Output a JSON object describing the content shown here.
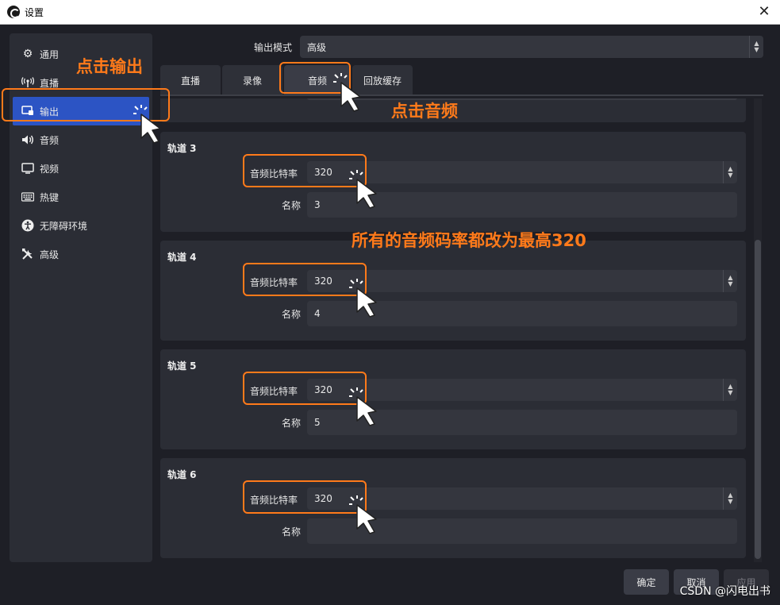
{
  "window": {
    "title": "设置",
    "close_glyph": "✕"
  },
  "sidebar": {
    "items": [
      {
        "label": "通用",
        "icon": "gear-icon",
        "glyph": "⚙"
      },
      {
        "label": "直播",
        "icon": "broadcast-icon",
        "glyph": "📡"
      },
      {
        "label": "输出",
        "icon": "output-icon",
        "glyph": "🖵"
      },
      {
        "label": "音频",
        "icon": "speaker-icon",
        "glyph": "🔊"
      },
      {
        "label": "视频",
        "icon": "monitor-icon",
        "glyph": "🖵"
      },
      {
        "label": "热键",
        "icon": "keyboard-icon",
        "glyph": "⌨"
      },
      {
        "label": "无障碍环境",
        "icon": "accessibility-icon",
        "glyph": "♿"
      },
      {
        "label": "高级",
        "icon": "tools-icon",
        "glyph": "✂"
      }
    ],
    "active_index": 2
  },
  "output_mode": {
    "label": "输出模式",
    "value": "高级"
  },
  "tabs": [
    {
      "label": "直播"
    },
    {
      "label": "录像"
    },
    {
      "label": "音频"
    },
    {
      "label": "回放缓存"
    }
  ],
  "active_tab": 2,
  "tracks": [
    {
      "title": "轨道 3",
      "bitrate_label": "音频比特率",
      "bitrate": "320",
      "name_label": "名称",
      "name": "3"
    },
    {
      "title": "轨道 4",
      "bitrate_label": "音频比特率",
      "bitrate": "320",
      "name_label": "名称",
      "name": "4"
    },
    {
      "title": "轨道 5",
      "bitrate_label": "音频比特率",
      "bitrate": "320",
      "name_label": "名称",
      "name": "5"
    },
    {
      "title": "轨道 6",
      "bitrate_label": "音频比特率",
      "bitrate": "320",
      "name_label": "名称",
      "name": ""
    }
  ],
  "buttons": {
    "ok": "确定",
    "cancel": "取消",
    "apply": "应用"
  },
  "annotations": {
    "click_output": "点击输出",
    "click_audio": "点击音频",
    "set_bitrate": "所有的音频码率都改为最高320"
  },
  "watermark_credit": "CSDN @闪电出书",
  "colors": {
    "accent": "#2c54c4",
    "annotation": "#ff7a1a",
    "background": "#1e1f26",
    "panel": "#2b2d35"
  }
}
